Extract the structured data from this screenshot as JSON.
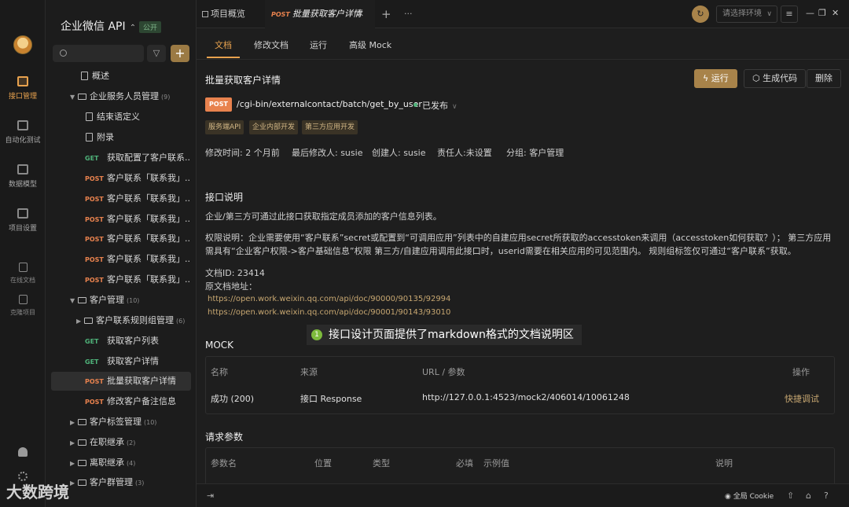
{
  "rail": {
    "items": [
      {
        "label": "接口管理"
      },
      {
        "label": "自动化测试"
      },
      {
        "label": "数据模型"
      },
      {
        "label": "项目设置"
      },
      {
        "label": "在线文档"
      },
      {
        "label": "克隆项目"
      }
    ]
  },
  "sidebar": {
    "project_title": "企业微信 API",
    "public_badge": "公开",
    "add_label": "+",
    "tree": [
      {
        "type": "doc",
        "label": "概述"
      },
      {
        "type": "folder",
        "label": "企业服务人员管理",
        "count": "(9)"
      },
      {
        "type": "doc",
        "label": "结束语定义"
      },
      {
        "type": "doc",
        "label": "附录"
      },
      {
        "type": "api",
        "method": "GET",
        "label": "获取配置了客户联系..."
      },
      {
        "type": "api",
        "method": "POST",
        "label": "客户联系「联系我」..."
      },
      {
        "type": "api",
        "method": "POST",
        "label": "客户联系「联系我」..."
      },
      {
        "type": "api",
        "method": "POST",
        "label": "客户联系「联系我」..."
      },
      {
        "type": "api",
        "method": "POST",
        "label": "客户联系「联系我」..."
      },
      {
        "type": "api",
        "method": "POST",
        "label": "客户联系「联系我」..."
      },
      {
        "type": "api",
        "method": "POST",
        "label": "客户联系「联系我」..."
      },
      {
        "type": "folder",
        "label": "客户管理",
        "count": "(10)"
      },
      {
        "type": "folder",
        "label": "客户联系规则组管理",
        "count": "(6)"
      },
      {
        "type": "api",
        "method": "GET",
        "label": "获取客户列表"
      },
      {
        "type": "api",
        "method": "GET",
        "label": "获取客户详情"
      },
      {
        "type": "api",
        "method": "POST",
        "label": "批量获取客户详情"
      },
      {
        "type": "api",
        "method": "POST",
        "label": "修改客户备注信息"
      },
      {
        "type": "folder",
        "label": "客户标签管理",
        "count": "(10)"
      },
      {
        "type": "folder",
        "label": "在职继承",
        "count": "(2)"
      },
      {
        "type": "folder",
        "label": "离职继承",
        "count": "(4)"
      },
      {
        "type": "folder",
        "label": "客户群管理",
        "count": "(3)"
      }
    ]
  },
  "topbar": {
    "overview_label": "项目概览",
    "current_tab_method": "POST",
    "current_tab_title": "批量获取客户详情",
    "env_placeholder": "请选择环境"
  },
  "main": {
    "subtabs": [
      "文档",
      "修改文档",
      "运行",
      "高级 Mock"
    ],
    "title": "批量获取客户详情",
    "buttons": {
      "run": "运行",
      "generate": "生成代码",
      "delete": "删除"
    },
    "method": "POST",
    "path": "/cgi-bin/externalcontact/batch/get_by_user",
    "status": "已发布",
    "tags": [
      "服务端API",
      "企业内部开发",
      "第三方应用开发"
    ],
    "meta": {
      "modified": "修改时间: 2 个月前",
      "modifier": "最后修改人: susie",
      "creator": "创建人: susie",
      "owner": "责任人:未设置",
      "group": "分组: 客户管理"
    },
    "desc_heading": "接口说明",
    "desc_line1": "企业/第三方可通过此接口获取指定成员添加的客户信息列表。",
    "desc_perm": "权限说明：企业需要使用“客户联系”secret或配置到“可调用应用”列表中的自建应用secret所获取的accesstoken来调用（accesstoken如何获取？）； 第三方应用需具有“企业客户权限->客户基础信息”权限 第三方/自建应用调用此接口时，userid需要在相关应用的可见范围内。 规则组标签仅可通过“客户联系”获取。",
    "doc_id": "文档ID: 23414",
    "doc_source": "原文档地址：",
    "links": [
      "https://open.work.weixin.qq.com/api/doc/90000/90135/92994",
      "https://open.work.weixin.qq.com/api/doc/90001/90143/93010"
    ],
    "callout_number": "1",
    "callout_text": "接口设计页面提供了markdown格式的文档说明区",
    "mock": {
      "heading": "MOCK",
      "headers": [
        "名称",
        "来源",
        "URL / 参数",
        "操作"
      ],
      "row": {
        "name": "成功 (200)",
        "source": "接口 Response",
        "url": "http://127.0.0.1:4523/mock2/406014/10061248",
        "action": "快捷调试"
      }
    },
    "params": {
      "heading": "请求参数",
      "headers": [
        "参数名",
        "位置",
        "类型",
        "必填",
        "示例值",
        "说明"
      ]
    }
  },
  "bottombar": {
    "cookie_label": "全局 Cookie"
  },
  "watermark": "大数跨境"
}
